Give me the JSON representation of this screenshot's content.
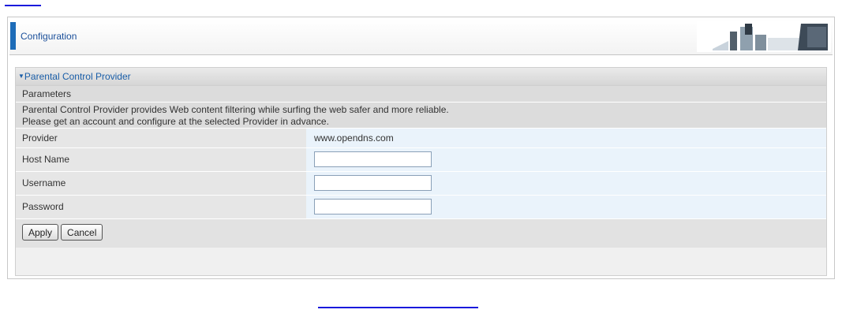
{
  "header": {
    "title": "Configuration"
  },
  "section": {
    "title": "Parental Control Provider",
    "parameters_label": "Parameters",
    "description_line1": "Parental Control Provider provides Web content filtering while surfing the web safer and more reliable.",
    "description_line2": "Please get an account and configure at the selected Provider in advance."
  },
  "fields": {
    "provider_label": "Provider",
    "provider_value": "www.opendns.com",
    "hostname_label": "Host Name",
    "hostname_value": "",
    "username_label": "Username",
    "username_value": "",
    "password_label": "Password",
    "password_value": ""
  },
  "buttons": {
    "apply": "Apply",
    "cancel": "Cancel"
  },
  "colors": {
    "accent": "#1d6cb8",
    "section_title": "#1a5ea8",
    "link": "#1a1adc",
    "value_bg": "#eaf3fb"
  },
  "icons": {
    "section_arrow": "triangle-down-icon"
  }
}
